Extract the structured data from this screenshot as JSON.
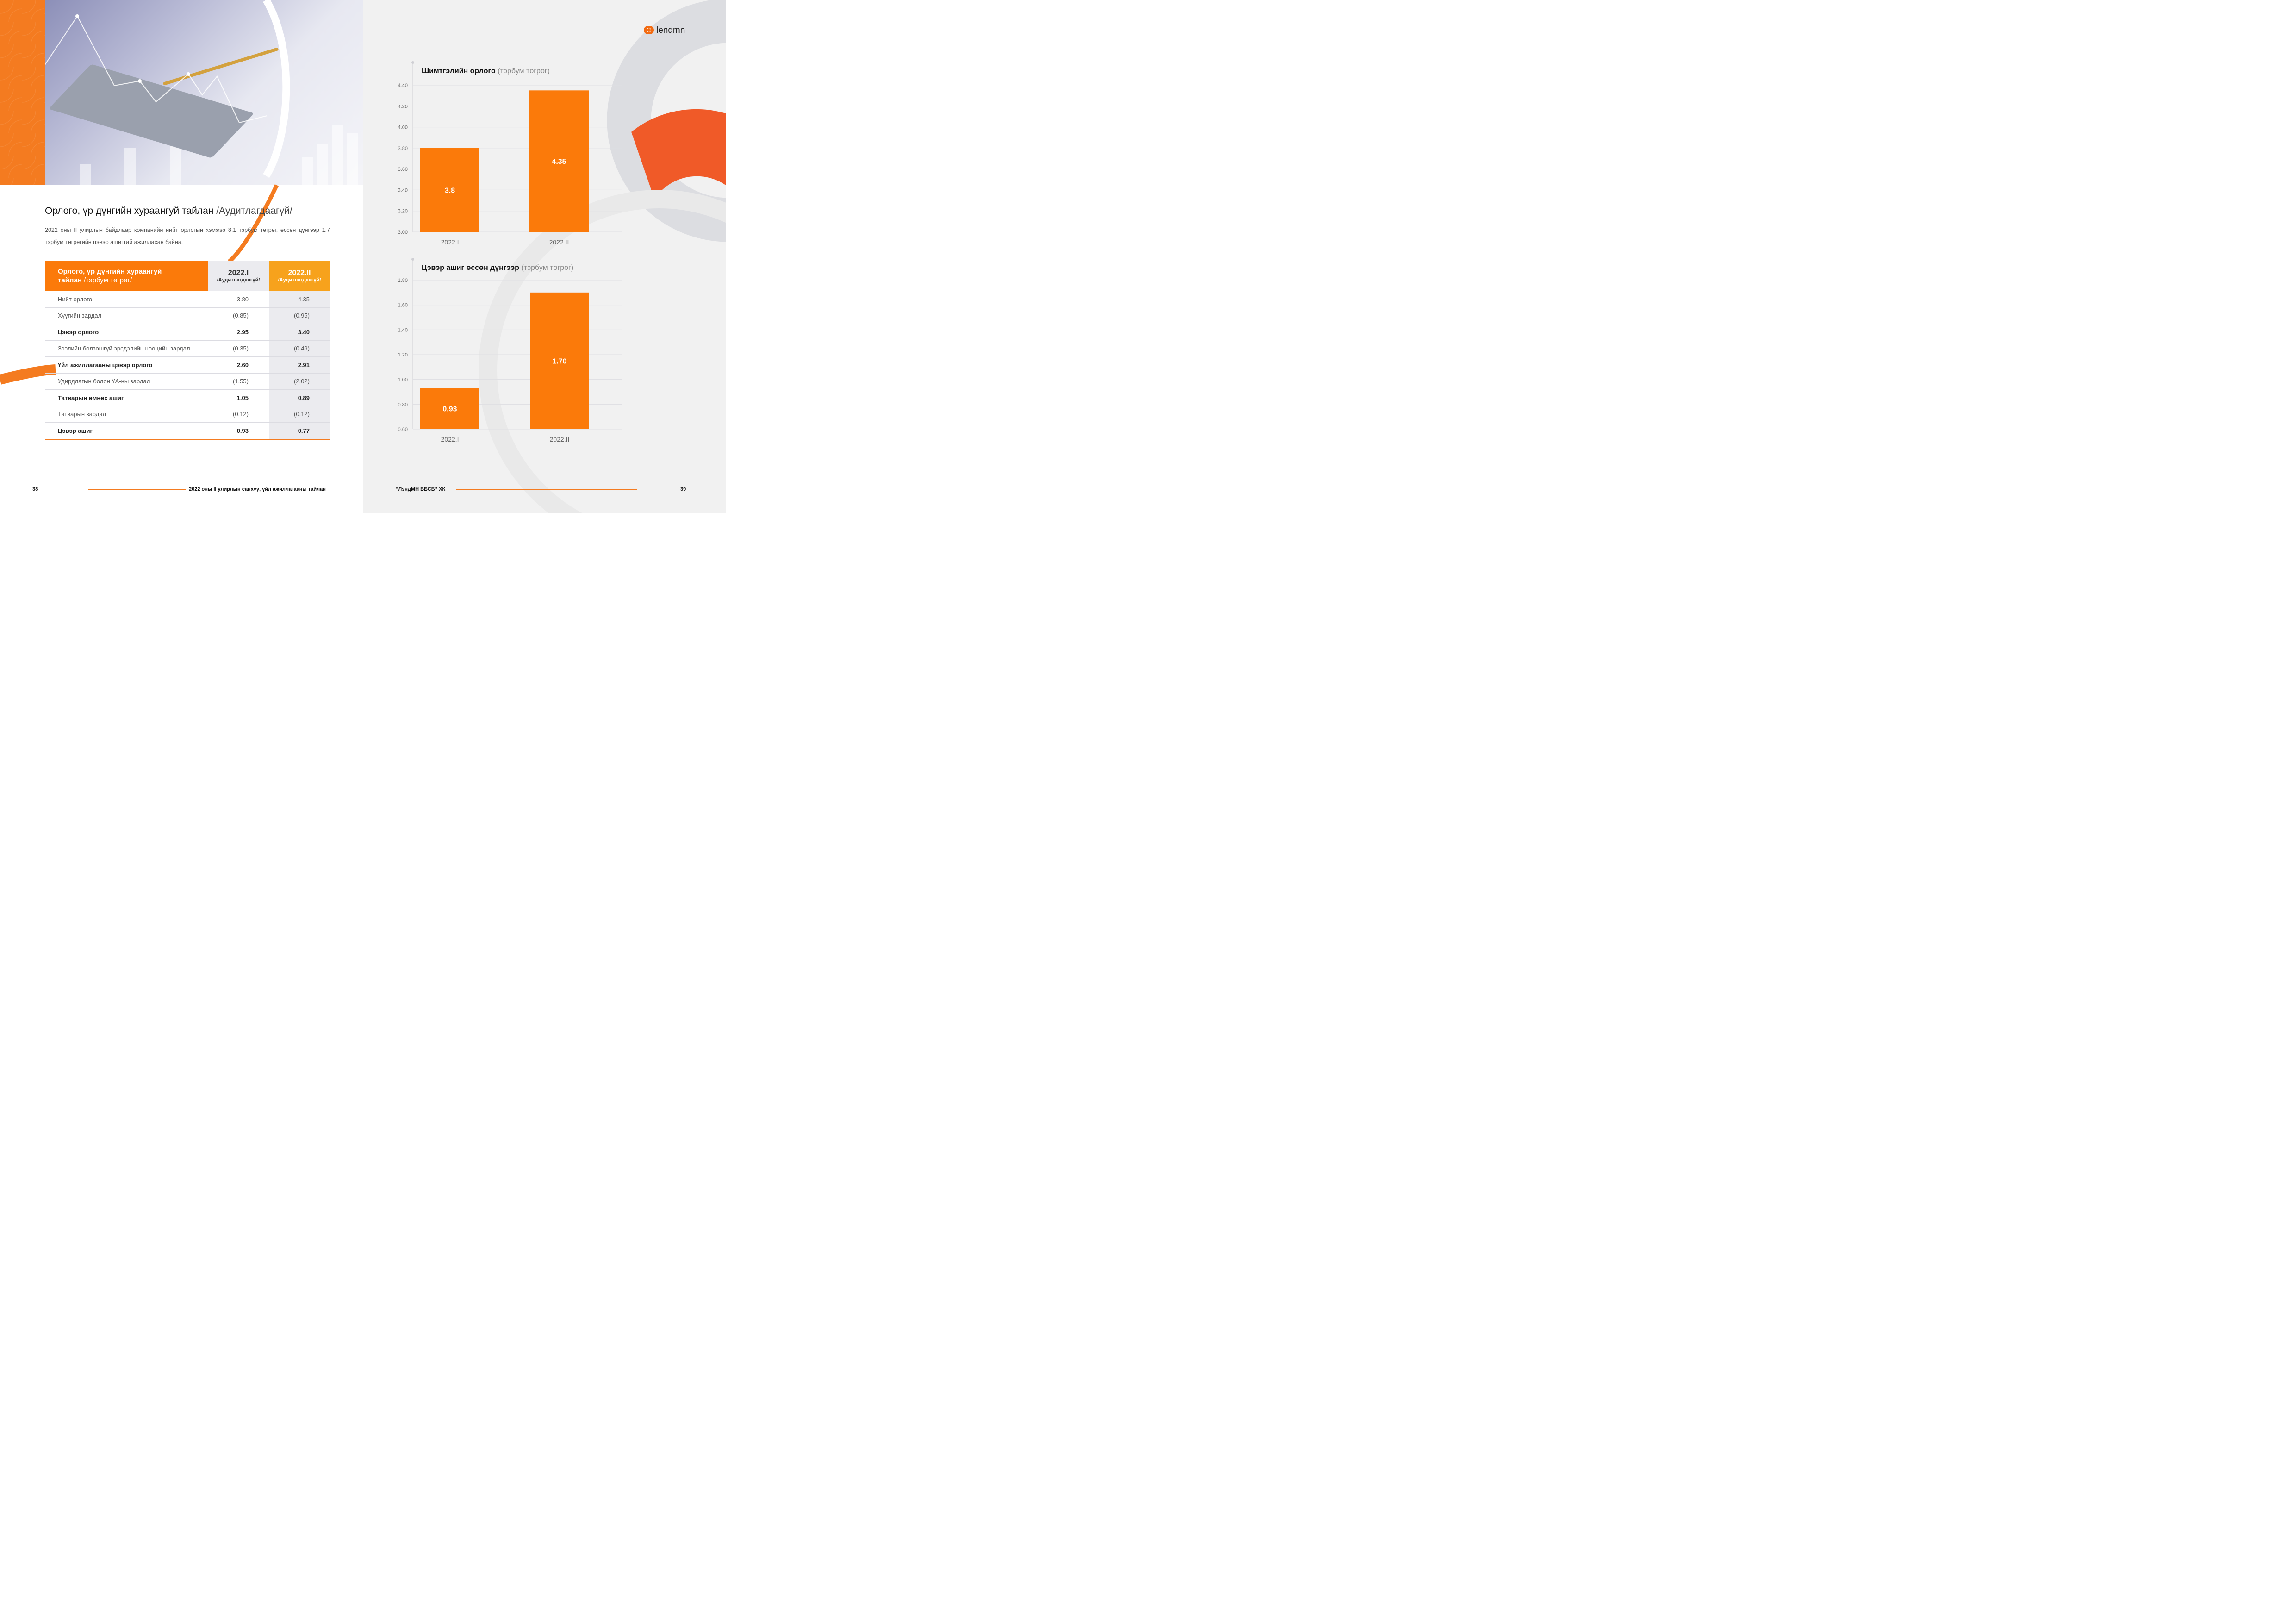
{
  "left_page": {
    "report_title": "Орлого, үр дүнгийн хураангуй тайлан",
    "report_title_suffix": "/Аудитлагдаагүй/",
    "intro": "2022 оны II улирлын байдлаар компанийн нийт орлогын хэмжээ 8.1 тэрбум төгрөг, өссөн дүнгээр 1.7 тэрбум төгрөгийн цэвэр ашигтай ажилласан байна.",
    "table": {
      "header_title": "Орлого, үр дүнгийн хураангуй",
      "header_title_2": "тайлан",
      "header_unit": "/тэрбум төгрөг/",
      "col1_year": "2022.I",
      "col1_note": "/Аудитлагдаагүй/",
      "col2_year": "2022.II",
      "col2_note": "/Аудитлагдаагүй/",
      "rows": [
        {
          "label": "Нийт орлого",
          "v1": "3.80",
          "v2": "4.35",
          "bold": false
        },
        {
          "label": "Хүүгийн зардал",
          "v1": "(0.85)",
          "v2": "(0.95)",
          "bold": false
        },
        {
          "label": "Цэвэр орлого",
          "v1": "2.95",
          "v2": "3.40",
          "bold": true
        },
        {
          "label": "Зээлийн болзошгүй эрсдэлийн нөөцийн зардал",
          "v1": "(0.35)",
          "v2": "(0.49)",
          "bold": false
        },
        {
          "label": "Үйл ажиллагааны цэвэр орлого",
          "v1": "2.60",
          "v2": "2.91",
          "bold": true
        },
        {
          "label": "Удирдлагын болон ҮА-ны зардал",
          "v1": "(1.55)",
          "v2": "(2.02)",
          "bold": false
        },
        {
          "label": "Татварын өмнөх ашиг",
          "v1": "1.05",
          "v2": "0.89",
          "bold": true
        },
        {
          "label": "Татварын зардал",
          "v1": "(0.12)",
          "v2": "(0.12)",
          "bold": false
        },
        {
          "label": "Цэвэр ашиг",
          "v1": "0.93",
          "v2": "0.77",
          "bold": true
        }
      ]
    },
    "footer": {
      "page_number": "38",
      "text": "2022 оны II улирлын санхүү, үйл ажиллагааны тайлан"
    }
  },
  "right_page": {
    "logo_text": "lendmn",
    "footer": {
      "company": "“ЛэндМН ББСБ” ХК",
      "page_number": "39"
    }
  },
  "colors": {
    "accent": "#fb7a0a",
    "accent_light": "#f7a21c",
    "accent_dark": "#f0592a",
    "text": "#222222",
    "muted": "#888888"
  },
  "chart_data": [
    {
      "type": "bar",
      "title": "Шимтгэлийн орлого",
      "unit": "(тэрбум төгрөг)",
      "categories": [
        "2022.I",
        "2022.II"
      ],
      "values": [
        3.8,
        4.35
      ],
      "value_labels": [
        "3.8",
        "4.35"
      ],
      "yticks": [
        "3.00",
        "3.20",
        "3.40",
        "3.60",
        "3.80",
        "4.00",
        "4.20",
        "4.40"
      ],
      "ylim": [
        3.0,
        4.4
      ],
      "grid": true
    },
    {
      "type": "bar",
      "title": "Цэвэр ашиг өссөн дүнгээр",
      "unit": "(тэрбум төгрөг)",
      "categories": [
        "2022.I",
        "2022.II"
      ],
      "values": [
        0.93,
        1.7
      ],
      "value_labels": [
        "0.93",
        "1.70"
      ],
      "yticks": [
        "0.60",
        "0.80",
        "1.00",
        "1.20",
        "1.40",
        "1.60",
        "1.80"
      ],
      "ylim": [
        0.6,
        1.8
      ],
      "grid": true
    }
  ]
}
